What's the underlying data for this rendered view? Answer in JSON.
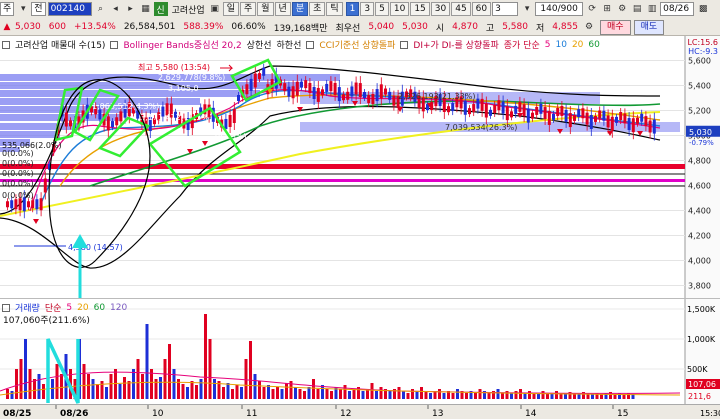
{
  "toolbar": {
    "row1": {
      "market": "주",
      "view": "전",
      "code": "002140",
      "name": "고려산업",
      "periods": [
        "일",
        "주",
        "월",
        "년",
        "분",
        "초",
        "틱"
      ],
      "active_period": "분",
      "intervals": [
        "1",
        "3",
        "5",
        "10",
        "15",
        "30",
        "45",
        "60"
      ],
      "active_interval": "1",
      "interval_select": "3",
      "count": "140/900",
      "date": "08/26"
    },
    "row2": {
      "price": "5,030",
      "change": "600",
      "change_pct": "+13.54%",
      "volume": "26,584,501",
      "vol_ratio": "588.39%",
      "turnover": "06.60%",
      "amount": "139,168백만",
      "best_ask_label": "최우선",
      "best_ask": "5,040",
      "best_bid": "5,030",
      "open_label": "시",
      "open": "4,870",
      "high_label": "고",
      "high": "5,580",
      "low_label": "저",
      "low": "4,855",
      "buy_label": "매수",
      "sell_label": "매도"
    }
  },
  "legend": {
    "title": "고려산업 매물대 수(15)",
    "bb": "Bollinger Bands중심선 20,2",
    "upper": "상한선",
    "lower": "하한선",
    "cci": "CCI기준선 상향돌파",
    "dmi": "DI+가 DI-를 상향돌파",
    "ma_label": "종가 단순",
    "ma_periods": [
      "5",
      "10",
      "20",
      "60"
    ],
    "right_top": "LC:15.6",
    "right_top2": "HC:-9.3"
  },
  "annotations": {
    "high_marker": "최고 5,580 (13:54)",
    "vol_profile": [
      "2,629,778(9.8%)",
      "3,105,0",
      "1,063,512(4.3%)",
      "0(1.3%)",
      "3,171,412(11.5%)",
      "535,066(2.0%)",
      "0(0.0%)",
      "0(0.0%)",
      "0(0.0%)",
      "0(0.0%)",
      "0(0.0%)"
    ],
    "profile_right": "2,326,193(21.33%)",
    "profile_right2": "7,039,534(26.3%)",
    "low_marker": "4,380 (14:57)",
    "current_price_tag": "5,030",
    "pct_tag": "-0.79%"
  },
  "price_axis": [
    "5,600",
    "5,400",
    "5,200",
    "5,000",
    "4,800",
    "4,600",
    "4,400",
    "4,200",
    "4,000",
    "3,800"
  ],
  "volume_panel": {
    "legend_vol": "거래량",
    "legend_ma": "단순",
    "legend_ma_periods": [
      "5",
      "20",
      "60",
      "120"
    ],
    "current": "107,060주(211.6%)",
    "axis": [
      "1,500K",
      "1,000K",
      "500K"
    ],
    "axis_tag": "107,06",
    "axis_tag2": "211,6"
  },
  "x_axis": {
    "labels": [
      "08/25",
      "08/26",
      "10",
      "11",
      "12",
      "13",
      "14",
      "15"
    ],
    "right_label": "15:30"
  },
  "colors": {
    "candle_up": "#e00020",
    "candle_down": "#1d2fd6",
    "bb_band": "#000000",
    "ma5": "#e6007a",
    "ma10": "#1b7cd8",
    "ma20": "#e8a000",
    "ma60": "#119933",
    "ma_long": "#f0f020",
    "profile": "#7a7ef0",
    "annotation_green": "#33ee33",
    "annotation_cyan": "#22dddd"
  }
}
